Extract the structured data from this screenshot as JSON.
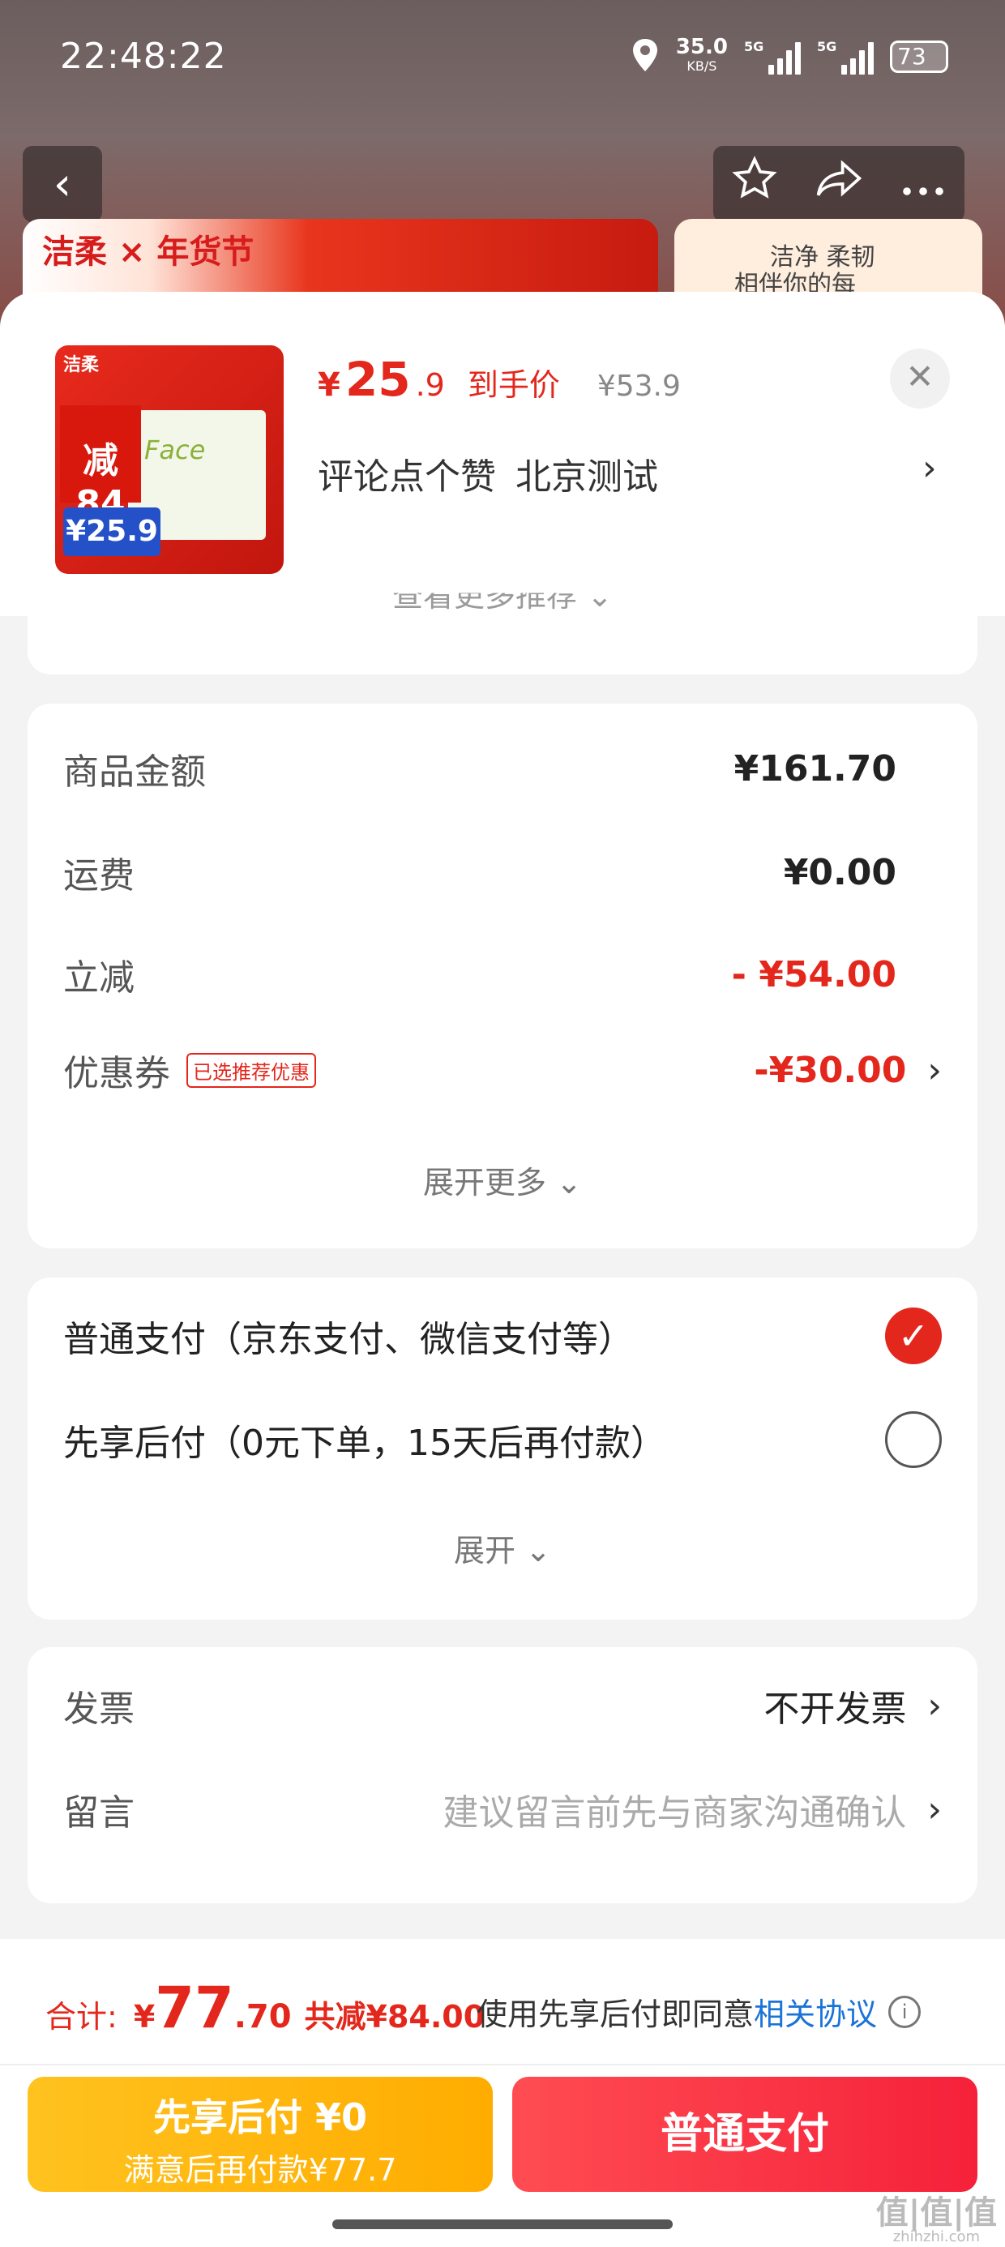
{
  "status_bar": {
    "time": "22:48:22",
    "speed": "35.0",
    "speed_unit": "KB/S",
    "net1": "5G",
    "net2": "5G",
    "battery": "73"
  },
  "top_nav": {
    "back_icon": "chevron-left-icon",
    "star_icon": "star-icon",
    "share_icon": "share-icon",
    "more_icon": "more-icon"
  },
  "banner": {
    "brand": "洁柔",
    "festival": "年货节",
    "slogan_1": "洁净 柔韧",
    "slogan_2": "相伴你的每"
  },
  "product": {
    "currency": "¥",
    "price_int": "25",
    "price_dec": ".9",
    "price_label": "到手价",
    "original_price": "¥53.9",
    "spec": "评论点个赞 北京测试",
    "thumb_badge": "减84",
    "thumb_price": "¥25.9",
    "thumb_brand": "洁柔",
    "thumb_box": "Face"
  },
  "recommend_partial": "查看更多推荐",
  "summary": {
    "rows": [
      {
        "label": "商品金额",
        "value": "¥161.70"
      },
      {
        "label": "运费",
        "value": "¥0.00"
      },
      {
        "label": "立减",
        "value": "- ¥54.00"
      },
      {
        "label": "优惠券",
        "tag": "已选推荐优惠",
        "value": "-¥30.00"
      }
    ],
    "expand": "展开更多"
  },
  "payment": {
    "options": [
      {
        "label": "普通支付（京东支付、微信支付等）",
        "selected": true
      },
      {
        "label": "先享后付（0元下单，15天后再付款）",
        "selected": false
      }
    ],
    "expand": "展开"
  },
  "extras": {
    "invoice_label": "发票",
    "invoice_value": "不开发票",
    "note_label": "留言",
    "note_placeholder": "建议留言前先与商家沟通确认"
  },
  "footer": {
    "total_label": "合计:",
    "currency": "¥",
    "total_int": "77",
    "total_dec": ".70",
    "saved": "共减¥84.00",
    "agree_text": "使用先享后付即同意",
    "agree_link": "相关协议",
    "btn_later_title": "先享后付 ¥0",
    "btn_later_sub": "满意后再付款¥77.7",
    "btn_pay": "普通支付"
  },
  "watermark": {
    "main": "值|值|值",
    "sub": "zhihzhi.com"
  },
  "colors": {
    "accent": "#e4271c",
    "link": "#1a73d8",
    "later_btn": "#ffb300",
    "pay_btn": "#f5213a"
  }
}
